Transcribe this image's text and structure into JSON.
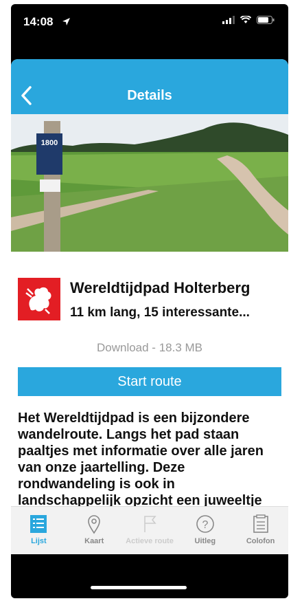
{
  "status": {
    "time": "14:08"
  },
  "nav": {
    "title": "Details"
  },
  "route": {
    "title": "Wereldtijdpad Holterberg",
    "subtitle": "11 km lang, 15 interessante...",
    "download": "Download - 18.3 MB",
    "start_label": "Start route",
    "description": "Het Wereldtijdpad is een bijzondere wandelroute. Langs het pad staan paaltjes met informatie over alle jaren van onze jaartelling. Deze rondwandeling is ook in landschappelijk opzicht een juweeltje",
    "hero_sign_text": "1800"
  },
  "tabs": [
    {
      "label": "Lijst",
      "icon": "list-icon",
      "state": "active"
    },
    {
      "label": "Kaart",
      "icon": "map-pin-icon",
      "state": "normal"
    },
    {
      "label": "Actieve route",
      "icon": "flag-icon",
      "state": "disabled"
    },
    {
      "label": "Uitleg",
      "icon": "help-icon",
      "state": "normal"
    },
    {
      "label": "Colofon",
      "icon": "document-icon",
      "state": "normal"
    }
  ],
  "colors": {
    "accent": "#2aa7dd",
    "logo_red": "#e31e24"
  }
}
